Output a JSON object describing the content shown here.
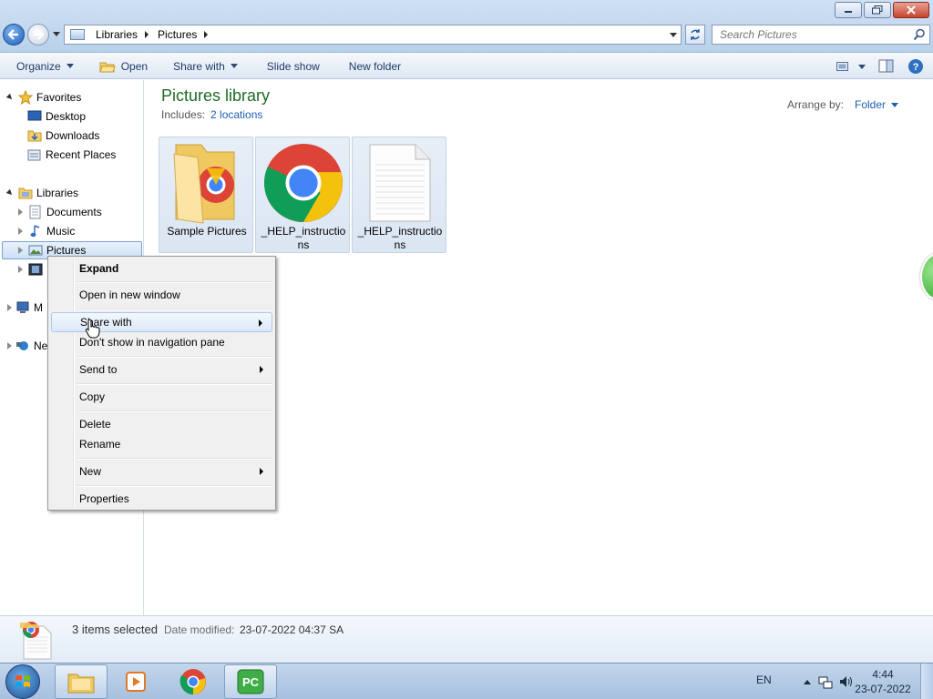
{
  "window": {
    "breadcrumb": [
      "Libraries",
      "Pictures"
    ],
    "search_placeholder": "Search Pictures"
  },
  "toolbar": {
    "organize": "Organize",
    "open": "Open",
    "share_with": "Share with",
    "slide_show": "Slide show",
    "new_folder": "New folder"
  },
  "navpane": {
    "favorites": "Favorites",
    "desktop": "Desktop",
    "downloads": "Downloads",
    "recent_places": "Recent Places",
    "libraries": "Libraries",
    "documents": "Documents",
    "music": "Music",
    "pictures": "Pictures",
    "computer_partial": "M",
    "network_partial": "Ne"
  },
  "content": {
    "title": "Pictures library",
    "includes_label": "Includes:",
    "includes_link": "2 locations",
    "arrange_label": "Arrange by:",
    "arrange_value": "Folder",
    "items": [
      {
        "label": "Sample Pictures",
        "icon": "folder-icon"
      },
      {
        "label": "_HELP_instructions",
        "icon": "chrome-icon"
      },
      {
        "label": "_HELP_instructions",
        "icon": "text-file-icon"
      }
    ]
  },
  "context_menu": {
    "expand": "Expand",
    "open_new_window": "Open in new window",
    "share_with": "Share with",
    "dont_show": "Don't show in navigation pane",
    "send_to": "Send to",
    "copy": "Copy",
    "delete": "Delete",
    "rename": "Rename",
    "new": "New",
    "properties": "Properties"
  },
  "details": {
    "count": "3 items selected",
    "date_label": "Date modified:",
    "date_value": "23-07-2022 04:37 SA"
  },
  "taskbar": {
    "language": "EN",
    "time": "4:44",
    "date": "23-07-2022"
  },
  "colors": {
    "accent_green": "#1e6b26",
    "link_blue": "#1e5fb0"
  }
}
